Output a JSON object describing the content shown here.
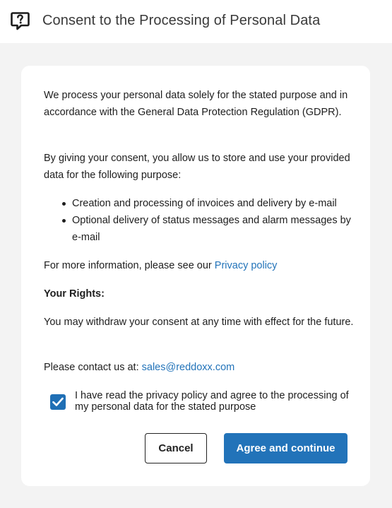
{
  "header": {
    "icon": "chat-question-icon",
    "title": "Consent to the Processing of Personal Data"
  },
  "body": {
    "intro": "We process your personal data solely for the stated purpose and in accordance with the General Data Protection Regulation (GDPR).",
    "consent_text": "By giving your consent, you allow us to store and use your provided data for the following purpose:",
    "purposes": [
      "Creation and processing of invoices and delivery by e-mail",
      "Optional delivery of status messages and alarm messages by e-mail"
    ],
    "more_info_prefix": "For more information, please see our ",
    "privacy_link": "Privacy policy",
    "rights_heading": "Your Rights:",
    "rights_text": "You may withdraw your consent at any time with effect for the future.",
    "contact_prefix": "Please contact us at: ",
    "contact_email": "sales@reddoxx.com"
  },
  "consent_checkbox": {
    "checked": true,
    "label": "I have read the privacy policy and agree to the processing of my personal data for the stated purpose"
  },
  "buttons": {
    "cancel": "Cancel",
    "agree": "Agree and continue"
  },
  "colors": {
    "accent": "#2273b9",
    "page_background": "#f3f3f3",
    "card_background": "#ffffff"
  }
}
